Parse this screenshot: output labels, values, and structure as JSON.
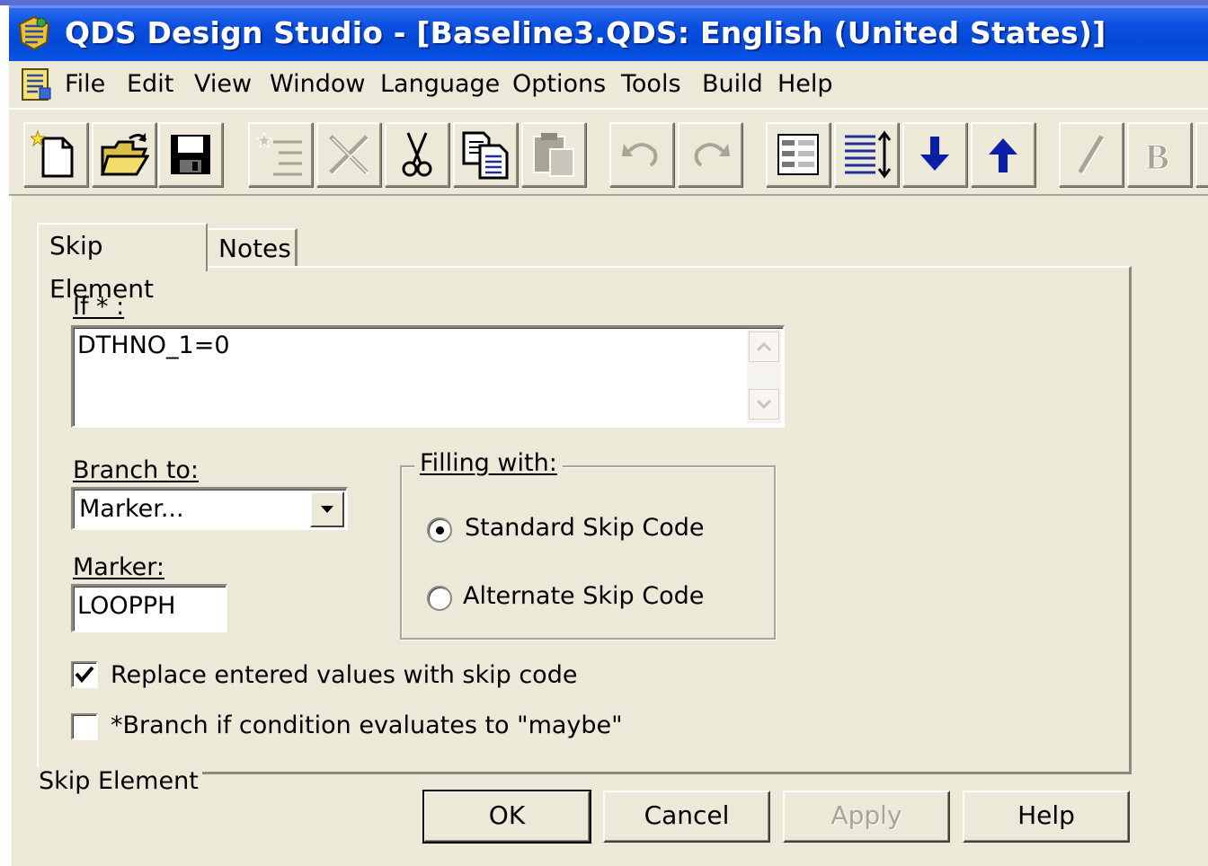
{
  "window": {
    "title": "QDS Design Studio - [Baseline3.QDS: English (United States)]"
  },
  "menu": {
    "items": [
      "File",
      "Edit",
      "View",
      "Window",
      "Language",
      "Options",
      "Tools",
      "Build",
      "Help"
    ]
  },
  "toolbar": {
    "buttons": [
      {
        "name": "new-document-icon",
        "enabled": true
      },
      {
        "name": "open-folder-icon",
        "enabled": true
      },
      {
        "name": "save-disk-icon",
        "enabled": true
      },
      {
        "name": "insert-element-icon",
        "enabled": false
      },
      {
        "name": "delete-icon",
        "enabled": false
      },
      {
        "name": "cut-icon",
        "enabled": true
      },
      {
        "name": "copy-icon",
        "enabled": true
      },
      {
        "name": "paste-icon",
        "enabled": false
      },
      {
        "name": "undo-icon",
        "enabled": false
      },
      {
        "name": "redo-icon",
        "enabled": false
      },
      {
        "name": "form-view-icon",
        "enabled": true
      },
      {
        "name": "outline-view-icon",
        "enabled": true
      },
      {
        "name": "move-down-icon",
        "enabled": true
      },
      {
        "name": "move-up-icon",
        "enabled": true
      },
      {
        "name": "italic-icon",
        "enabled": false
      },
      {
        "name": "bold-icon",
        "enabled": false
      }
    ]
  },
  "tabs": {
    "active": "Skip Element",
    "inactive": "Notes"
  },
  "form": {
    "if_label": "If * :",
    "if_value": "DTHNO_1=0",
    "branch_label": "Branch to:",
    "branch_value": "Marker...",
    "marker_label": "Marker:",
    "marker_value": "LOOPPH",
    "filling_label": "Filling with:",
    "radio_standard": "Standard Skip Code",
    "radio_alternate": "Alternate Skip Code",
    "radio_selected": "standard",
    "checkbox_replace": "Replace entered values with skip code",
    "checkbox_replace_checked": true,
    "checkbox_maybe": "*Branch if condition evaluates to \"maybe\"",
    "checkbox_maybe_checked": false
  },
  "footer": {
    "caption": "Skip Element"
  },
  "buttons": {
    "ok": "OK",
    "cancel": "Cancel",
    "apply": "Apply",
    "help": "Help"
  },
  "colors": {
    "titlebar": "#0449d6",
    "face": "#ece9d8",
    "arrow_blue": "#0b1fa8"
  }
}
